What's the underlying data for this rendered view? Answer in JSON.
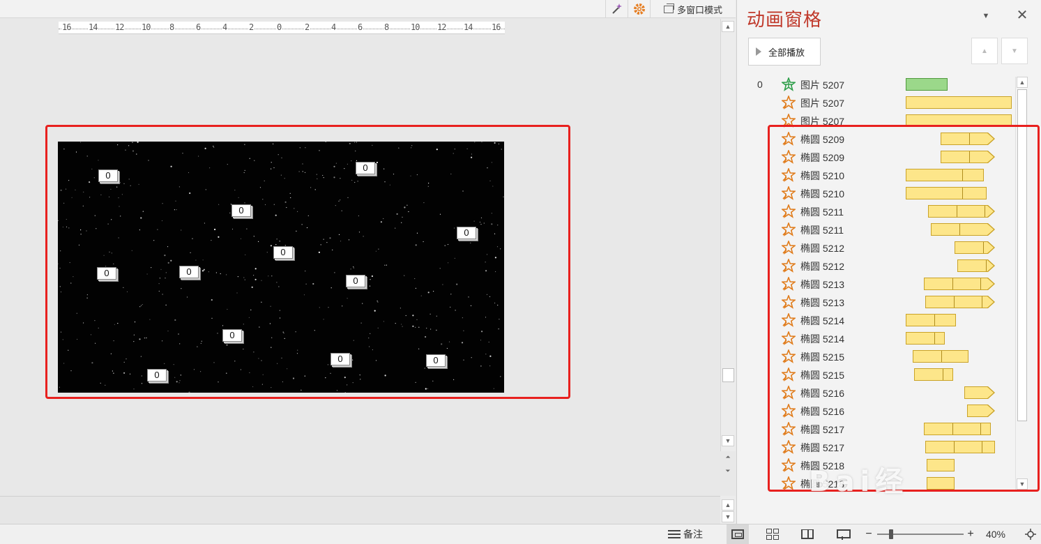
{
  "toolbar": {
    "multi_window_label": "多窗口模式"
  },
  "ruler": {
    "labels": [
      "16",
      "14",
      "12",
      "10",
      "8",
      "6",
      "4",
      "2",
      "0",
      "2",
      "4",
      "6",
      "8",
      "10",
      "12",
      "14",
      "16"
    ]
  },
  "slide": {
    "tags": [
      "0",
      "0",
      "0",
      "0",
      "0",
      "0",
      "0",
      "0",
      "0",
      "0",
      "0",
      "0",
      "0"
    ]
  },
  "pane": {
    "title": "动画窗格",
    "play_all_label": "全部播放",
    "rows": [
      {
        "num": "0",
        "label": "图片 5207",
        "type": "green"
      },
      {
        "num": "",
        "label": "图片 5207",
        "type": "emph"
      },
      {
        "num": "",
        "label": "图片 5207",
        "type": "emph"
      },
      {
        "num": "",
        "label": "椭圆 5209",
        "type": "emph"
      },
      {
        "num": "",
        "label": "椭圆 5209",
        "type": "emph"
      },
      {
        "num": "",
        "label": "椭圆 5210",
        "type": "emph"
      },
      {
        "num": "",
        "label": "椭圆 5210",
        "type": "emph"
      },
      {
        "num": "",
        "label": "椭圆 5211",
        "type": "emph"
      },
      {
        "num": "",
        "label": "椭圆 5211",
        "type": "emph"
      },
      {
        "num": "",
        "label": "椭圆 5212",
        "type": "emph"
      },
      {
        "num": "",
        "label": "椭圆 5212",
        "type": "emph"
      },
      {
        "num": "",
        "label": "椭圆 5213",
        "type": "emph"
      },
      {
        "num": "",
        "label": "椭圆 5213",
        "type": "emph"
      },
      {
        "num": "",
        "label": "椭圆 5214",
        "type": "emph"
      },
      {
        "num": "",
        "label": "椭圆 5214",
        "type": "emph"
      },
      {
        "num": "",
        "label": "椭圆 5215",
        "type": "emph"
      },
      {
        "num": "",
        "label": "椭圆 5215",
        "type": "emph"
      },
      {
        "num": "",
        "label": "椭圆 5216",
        "type": "emph"
      },
      {
        "num": "",
        "label": "椭圆 5216",
        "type": "emph"
      },
      {
        "num": "",
        "label": "椭圆 5217",
        "type": "emph"
      },
      {
        "num": "",
        "label": "椭圆 5217",
        "type": "emph"
      },
      {
        "num": "",
        "label": "椭圆 5218",
        "type": "emph"
      },
      {
        "num": "",
        "label": "椭圆 5218",
        "type": "emph"
      }
    ]
  },
  "statusbar": {
    "notes_label": "备注",
    "zoom_level": "40%"
  },
  "colors": {
    "highlight": "#e8201e",
    "title": "#c0392b",
    "bar_fill": "#fde68a",
    "green_fill": "#9bd88a"
  }
}
